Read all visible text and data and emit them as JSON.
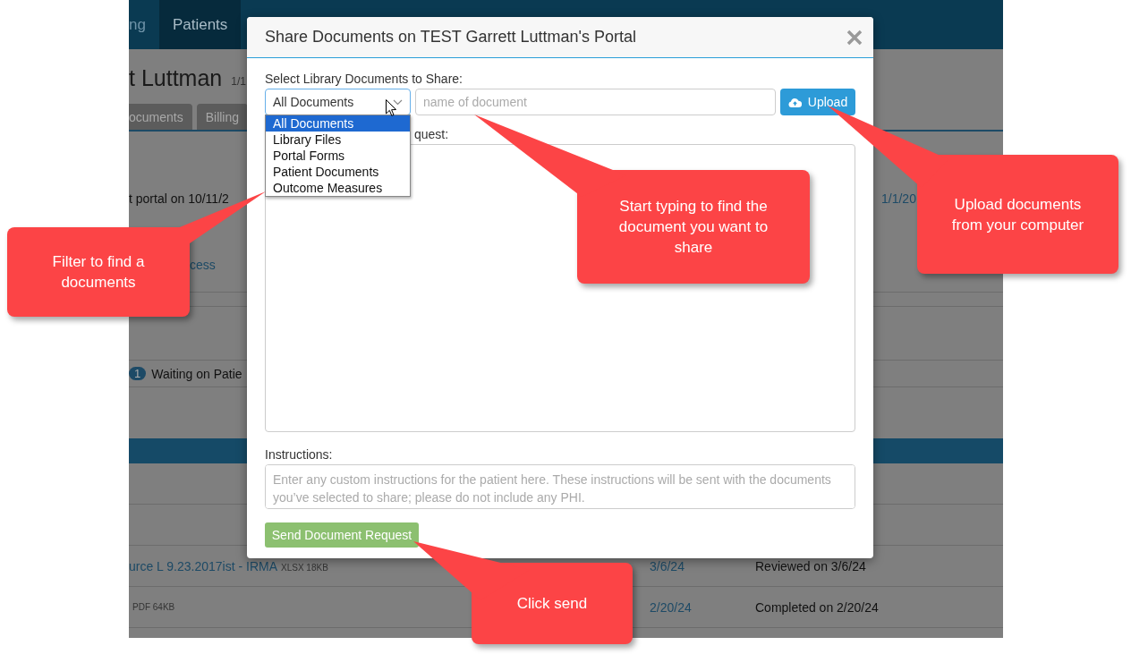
{
  "background_app": {
    "nav_items": [
      {
        "label": "ng",
        "selected": false
      },
      {
        "label": "Patients",
        "selected": true
      }
    ],
    "patient_name": "t Luttman",
    "patient_dob": "1/1",
    "tabs": [
      {
        "label": "ocuments"
      },
      {
        "label": "Billing"
      }
    ],
    "portal_note": "t portal on 10/11/2",
    "portal_date": "1/1/20",
    "access_link": "cess",
    "status_badge": {
      "count": "1",
      "label": "Waiting on Patie"
    },
    "document_rows": [
      {
        "name": "urce L 9.23.2017ist - IRMA",
        "file_info": "XLSX 18KB",
        "date": "3/6/24",
        "status": "Reviewed on 3/6/24"
      },
      {
        "file_info": "PDF 64KB",
        "date": "2/20/24",
        "status": "Completed on 2/20/24"
      }
    ]
  },
  "modal": {
    "title": "Share Documents on TEST Garrett Luttman's Portal",
    "library_label": "Select Library Documents to Share:",
    "filter_select": {
      "value": "All Documents",
      "expanded": true,
      "options": [
        {
          "label": "All Documents",
          "selected": true
        },
        {
          "label": "Library Files",
          "selected": false
        },
        {
          "label": "Portal Forms",
          "selected": false
        },
        {
          "label": "Patient Documents",
          "selected": false
        },
        {
          "label": "Outcome Measures",
          "selected": false
        }
      ]
    },
    "search_field": {
      "placeholder": "name of document"
    },
    "upload_button": "Upload",
    "request_label": "quest:",
    "instructions_label": "Instructions:",
    "instructions_field": {
      "placeholder": "Enter any custom instructions for the patient here. These instructions will be sent with the documents you’ve selected to share; please do not include any PHI."
    },
    "send_button": {
      "label": "Send Document Request",
      "disabled": true
    }
  },
  "callouts": [
    {
      "text": "Filter to find a documents"
    },
    {
      "text": "Start typing to find the document you want to share"
    },
    {
      "text": "Upload documents from your computer"
    },
    {
      "text": "Click send"
    }
  ]
}
